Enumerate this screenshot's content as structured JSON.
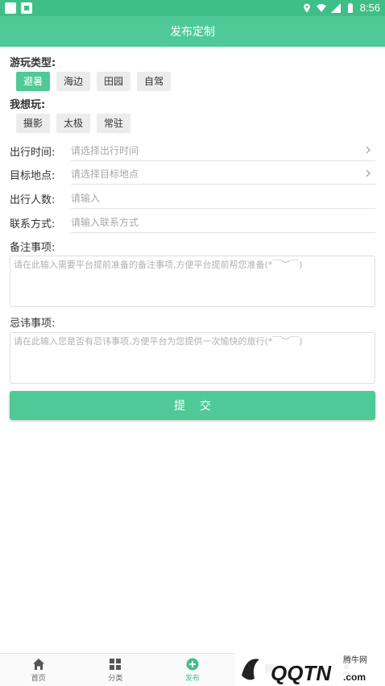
{
  "status_bar": {
    "time": "8:56"
  },
  "header": {
    "title": "发布定制"
  },
  "play_type": {
    "label": "游玩类型:",
    "options": [
      "避暑",
      "海边",
      "田园",
      "自驾"
    ],
    "selected": "避暑"
  },
  "want_play": {
    "label": "我想玩:",
    "options": [
      "摄影",
      "太极",
      "常驻"
    ]
  },
  "form": {
    "departure_time": {
      "label": "出行时间:",
      "placeholder": "请选择出行时间"
    },
    "destination": {
      "label": "目标地点:",
      "placeholder": "请选择目标地点"
    },
    "people": {
      "label": "出行人数:",
      "placeholder": "请输入"
    },
    "contact": {
      "label": "联系方式:",
      "placeholder": "请输入联系方式"
    }
  },
  "notes": {
    "label": "备注事项:",
    "placeholder": "请在此输入需要平台提前准备的备注事项,方便平台提前帮您准备(*￣︶￣)"
  },
  "taboos": {
    "label": "忌讳事项:",
    "placeholder": "请在此输入您是否有忌讳事项,方便平台为您提供一次愉快的旅行(*￣︶￣)"
  },
  "submit_label": "提交",
  "tabbar": {
    "tabs": [
      {
        "label": "首页",
        "icon": "home-icon"
      },
      {
        "label": "分类",
        "icon": "grid-icon"
      },
      {
        "label": "发布",
        "icon": "add-circle-icon",
        "active": true
      },
      {
        "label": "",
        "icon": "message-icon"
      },
      {
        "label": "",
        "icon": "user-icon"
      }
    ]
  },
  "watermark": {
    "text": "腾牛网",
    "logo_text": "QQTN.com"
  },
  "colors": {
    "primary": "#4fca96",
    "status_bar": "#3fbf88",
    "chip_bg": "#ececec"
  }
}
